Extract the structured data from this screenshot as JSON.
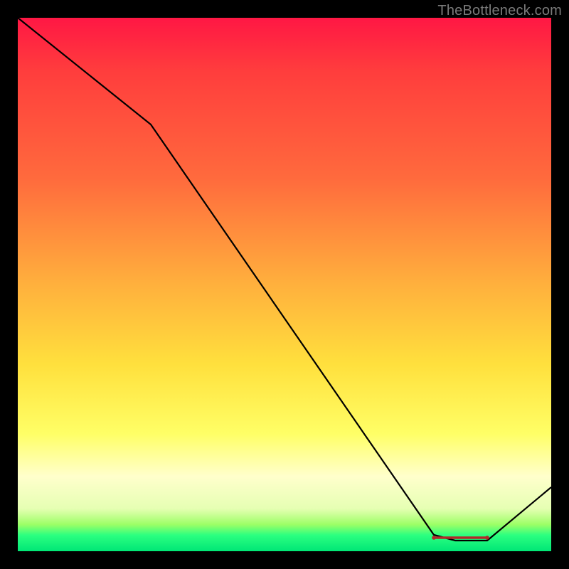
{
  "watermark": "TheBottleneck.com",
  "chart_data": {
    "type": "line",
    "title": "",
    "xlabel": "",
    "ylabel": "",
    "xlim": [
      0,
      100
    ],
    "ylim": [
      0,
      100
    ],
    "grid": false,
    "legend": false,
    "series": [
      {
        "name": "bottleneck-curve",
        "x": [
          0,
          25,
          78,
          82,
          88,
          100
        ],
        "y": [
          100,
          80,
          3,
          2,
          2,
          12
        ]
      }
    ],
    "highlight_segment": {
      "name": "minimum-region",
      "x": [
        78,
        88
      ],
      "y": [
        2.5,
        2.5
      ]
    },
    "gradient_stops": [
      {
        "pos": 0.0,
        "color": "#ff1744"
      },
      {
        "pos": 0.5,
        "color": "#ffb03d"
      },
      {
        "pos": 0.78,
        "color": "#ffff66"
      },
      {
        "pos": 0.92,
        "color": "#e6ffb3"
      },
      {
        "pos": 1.0,
        "color": "#00e676"
      }
    ]
  }
}
